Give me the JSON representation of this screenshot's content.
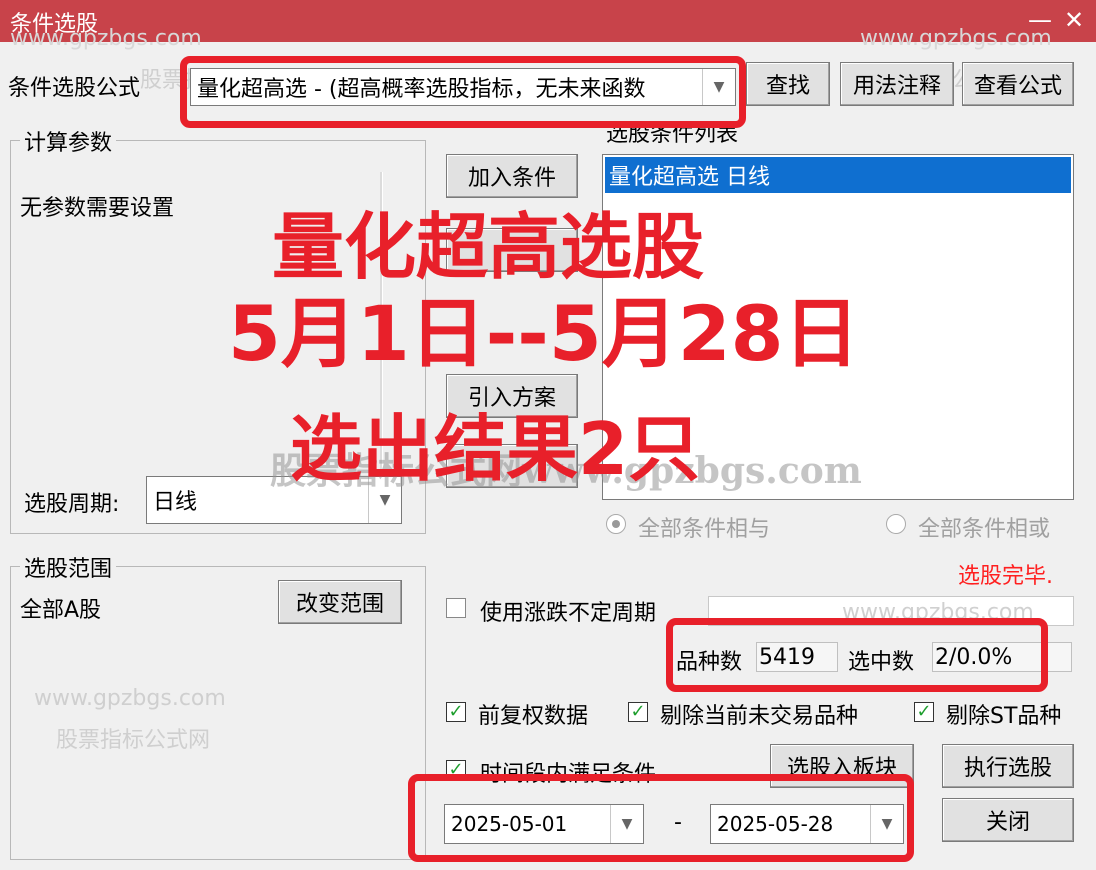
{
  "window": {
    "title": "条件选股",
    "minimize": "—",
    "close": "✕"
  },
  "watermarks": {
    "url": "www.gpzbgs.com",
    "name": "股票指标公式网",
    "center": "股票指标公式网www.gpzbgs.com"
  },
  "formula": {
    "label": "条件选股公式",
    "value": "量化超高选  -  (超高概率选股指标，无未来函数",
    "find_button": "查找",
    "usage_button": "用法注释",
    "view_button": "查看公式"
  },
  "params": {
    "group_label": "计算参数",
    "text": "无参数需要设置",
    "period_label": "选股周期:",
    "period_value": "日线"
  },
  "middle_buttons": {
    "add_condition": "加入条件",
    "import_plan": "引入方案"
  },
  "conditions": {
    "list_label": "选股条件列表",
    "items": [
      "量化超高选  日线"
    ],
    "radio_and": "全部条件相与",
    "radio_or": "全部条件相或",
    "status": "选股完毕."
  },
  "scope": {
    "group_label": "选股范围",
    "text": "全部A股",
    "change_button": "改变范围"
  },
  "options": {
    "use_variable_period": "使用涨跌不定周期",
    "count_label": "品种数",
    "count_value": "5419",
    "selected_label": "选中数",
    "selected_value": "2/0.0%",
    "pre_adjust": "前复权数据",
    "exclude_untraded": "剔除当前未交易品种",
    "exclude_st": "剔除ST品种",
    "time_range": "时间段内满足条件"
  },
  "dates": {
    "start": "2025-05-01",
    "separator": "-",
    "end": "2025-05-28"
  },
  "actions": {
    "to_block": "选股入板块",
    "execute": "执行选股",
    "close": "关闭"
  },
  "overlay": {
    "line1": "量化超高选股",
    "line2": "5月1日--5月28日",
    "line3": "选出结果2只"
  },
  "colors": {
    "title_bar": "#c8434a",
    "accent_red": "#e8202a",
    "selection": "#0f6fd0",
    "check_green": "#1e9e2e"
  }
}
